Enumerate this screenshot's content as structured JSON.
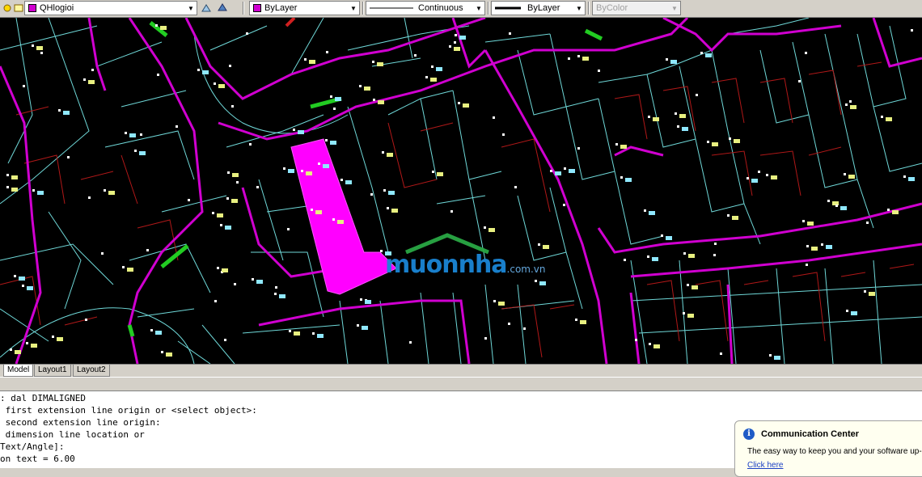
{
  "toolbar": {
    "layer_name": "QHlogioi",
    "layer_color": "#d000d0",
    "color_control": "ByLayer",
    "color_swatch": "#d000d0",
    "linetype_control": "Continuous",
    "lineweight_control": "ByLayer",
    "plotstyle_control": "ByColor"
  },
  "tabs": [
    "Model",
    "Layout1",
    "Layout2"
  ],
  "command_history": [
    ": dal DIMALIGNED",
    " first extension line origin or <select object>:",
    " second extension line origin:",
    " dimension line location or",
    "Text/Angle]:",
    "on text = 6.00"
  ],
  "notification": {
    "title": "Communication Center",
    "message": "The easy way to keep you and your software up-",
    "link": "Click here"
  },
  "watermark": {
    "brand": "muonnha",
    "suffix": ".com.vn"
  },
  "colors": {
    "canvas": "#000000",
    "boundary": "#d000d0",
    "parcel_lines": "#6fe0e0",
    "lot_lines": "#c02020",
    "highlight_lot": "#ff00ff"
  }
}
